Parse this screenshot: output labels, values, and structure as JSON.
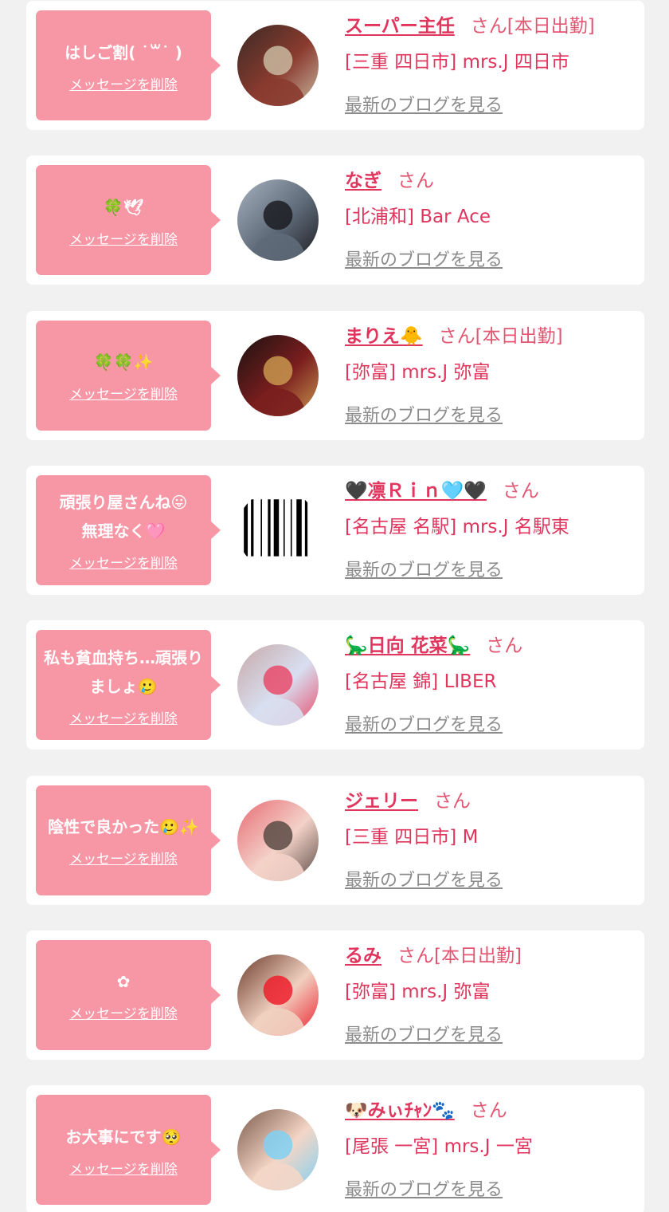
{
  "messages": [
    {
      "message": "はしご割( ˙꒳˙ )",
      "delete_label": "メッセージを削除",
      "name": "スーパー主任",
      "suffix": "さん[本日出勤]",
      "shop": "[三重 四日市] mrs.J 四日市",
      "blog_label": "最新のブログを見る",
      "avatar_icon": "profile-photo-red-hair-person",
      "avatar_colors": [
        "#3a2a24",
        "#8a3b2f",
        "#c9b8a0"
      ]
    },
    {
      "message": "🍀🕊",
      "delete_label": "メッセージを削除",
      "name": "なぎ",
      "suffix": "さん",
      "shop": "[北浦和] Bar Ace",
      "blog_label": "最新のブログを見る",
      "avatar_icon": "profile-photo-silhouette-lake",
      "avatar_colors": [
        "#a7b2bf",
        "#5e6a78",
        "#1c1c22"
      ]
    },
    {
      "message": "🍀🍀✨",
      "delete_label": "メッセージを削除",
      "name": "まりえ🐥",
      "suffix": "さん[本日出勤]",
      "shop": "[弥富] mrs.J 弥富",
      "blog_label": "最新のブログを見る",
      "avatar_icon": "profile-photo-teddy-bear",
      "avatar_colors": [
        "#1a1111",
        "#7a1e1e",
        "#c8964e"
      ]
    },
    {
      "message": "頑張り屋さんね😛\n無理なく🩷",
      "delete_label": "メッセージを削除",
      "name": "🖤凛Ｒｉｎ🩵🖤",
      "suffix": "さん",
      "shop": "[名古屋 名駅] mrs.J 名駅東",
      "blog_label": "最新のブログを見る",
      "avatar_icon": "profile-photo-barcode",
      "avatar_colors": [
        "#ffffff",
        "#000000",
        "#dddddd"
      ]
    },
    {
      "message": "私も貧血持ち…頑張りましょ🥲",
      "delete_label": "メッセージを削除",
      "name": "🦕日向 花菜🦕",
      "suffix": "さん",
      "shop": "[名古屋 錦] LIBER",
      "blog_label": "最新のブログを見る",
      "avatar_icon": "profile-photo-ball-pit",
      "avatar_colors": [
        "#c7a9a9",
        "#d8dff0",
        "#e84b6b"
      ]
    },
    {
      "message": "陰性で良かった🥲✨",
      "delete_label": "メッセージを削除",
      "name": "ジェリー",
      "suffix": "さん",
      "shop": "[三重 四日市] M",
      "blog_label": "最新のブログを見る",
      "avatar_icon": "profile-photo-girl-pink-background",
      "avatar_colors": [
        "#e86a74",
        "#f3d2c8",
        "#5b4a44"
      ]
    },
    {
      "message": "✿",
      "delete_label": "メッセージを削除",
      "name": "るみ",
      "suffix": "さん[本日出勤]",
      "shop": "[弥富] mrs.J 弥富",
      "blog_label": "最新のブログを見る",
      "avatar_icon": "profile-photo-heart-sticker",
      "avatar_colors": [
        "#6b3a2a",
        "#f0d0c0",
        "#ee1f2c"
      ]
    },
    {
      "message": "お大事にです🥺",
      "delete_label": "メッセージを削除",
      "name": "🐶みぃﾁｬﾝ🐾",
      "suffix": "さん",
      "shop": "[尾張 一宮] mrs.J 一宮",
      "blog_label": "最新のブログを見る",
      "avatar_icon": "profile-photo-blue-heart-sticker",
      "avatar_colors": [
        "#7b5a4a",
        "#f4d6c6",
        "#7fd0f2"
      ]
    }
  ]
}
